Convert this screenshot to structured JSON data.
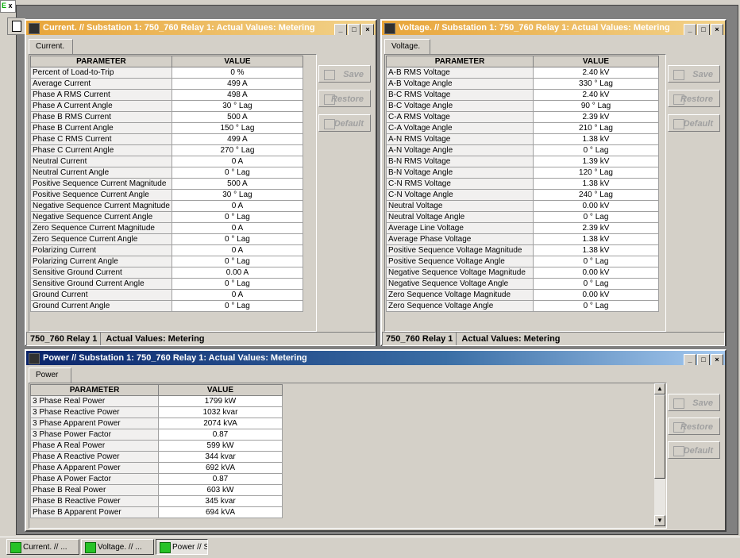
{
  "current_window": {
    "title": "Current. // Substation 1: 750_760 Relay 1: Actual Values: Metering",
    "tab": "Current.",
    "headers": [
      "PARAMETER",
      "VALUE"
    ],
    "rows": [
      [
        "Percent of Load-to-Trip",
        "0 %"
      ],
      [
        "Average Current",
        "499 A"
      ],
      [
        "Phase A RMS Current",
        "498 A"
      ],
      [
        "Phase A Current Angle",
        "30 ° Lag"
      ],
      [
        "Phase B RMS Current",
        "500 A"
      ],
      [
        "Phase B Current Angle",
        "150 ° Lag"
      ],
      [
        "Phase C RMS Current",
        "499 A"
      ],
      [
        "Phase C Current Angle",
        "270 ° Lag"
      ],
      [
        "Neutral Current",
        "0 A"
      ],
      [
        "Neutral Current Angle",
        "0 ° Lag"
      ],
      [
        "Positive Sequence Current Magnitude",
        "500 A"
      ],
      [
        "Positive Sequence Current Angle",
        "30 ° Lag"
      ],
      [
        "Negative Sequence Current Magnitude",
        "0 A"
      ],
      [
        "Negative Sequence Current Angle",
        "0 ° Lag"
      ],
      [
        "Zero Sequence Current Magnitude",
        "0 A"
      ],
      [
        "Zero Sequence Current Angle",
        "0 ° Lag"
      ],
      [
        "Polarizing Current",
        "0 A"
      ],
      [
        "Polarizing Current Angle",
        "0 ° Lag"
      ],
      [
        "Sensitive Ground Current",
        "0.00 A"
      ],
      [
        "Sensitive Ground Current Angle",
        "0 ° Lag"
      ],
      [
        "Ground Current",
        "0 A"
      ],
      [
        "Ground Current Angle",
        "0 ° Lag"
      ]
    ],
    "buttons": {
      "save": "Save",
      "restore": "Restore",
      "default": "Default"
    },
    "status_device": "750_760 Relay 1",
    "status_text": "Actual Values: Metering"
  },
  "voltage_window": {
    "title": "Voltage. // Substation 1: 750_760 Relay 1: Actual Values: Metering",
    "tab": "Voltage.",
    "headers": [
      "PARAMETER",
      "VALUE"
    ],
    "rows": [
      [
        "A-B RMS Voltage",
        "2.40 kV"
      ],
      [
        "A-B Voltage Angle",
        "330 ° Lag"
      ],
      [
        "B-C RMS Voltage",
        "2.40 kV"
      ],
      [
        "B-C Voltage Angle",
        "90 ° Lag"
      ],
      [
        "C-A RMS Voltage",
        "2.39 kV"
      ],
      [
        "C-A Voltage Angle",
        "210 ° Lag"
      ],
      [
        "A-N RMS Voltage",
        "1.38 kV"
      ],
      [
        "A-N Voltage Angle",
        "0 ° Lag"
      ],
      [
        "B-N RMS Voltage",
        "1.39 kV"
      ],
      [
        "B-N Voltage Angle",
        "120 ° Lag"
      ],
      [
        "C-N RMS Voltage",
        "1.38 kV"
      ],
      [
        "C-N Voltage Angle",
        "240 ° Lag"
      ],
      [
        "Neutral Voltage",
        "0.00 kV"
      ],
      [
        "Neutral Voltage Angle",
        "0 ° Lag"
      ],
      [
        "Average Line Voltage",
        "2.39 kV"
      ],
      [
        "Average Phase Voltage",
        "1.38 kV"
      ],
      [
        "Positive Sequence Voltage Magnitude",
        "1.38 kV"
      ],
      [
        "Positive Sequence Voltage Angle",
        "0 ° Lag"
      ],
      [
        "Negative Sequence Voltage Magnitude",
        "0.00 kV"
      ],
      [
        "Negative Sequence Voltage Angle",
        "0 ° Lag"
      ],
      [
        "Zero Sequence Voltage Magnitude",
        "0.00 kV"
      ],
      [
        "Zero Sequence Voltage Angle",
        "0 ° Lag"
      ]
    ],
    "buttons": {
      "save": "Save",
      "restore": "Restore",
      "default": "Default"
    },
    "status_device": "750_760 Relay 1",
    "status_text": "Actual Values: Metering"
  },
  "power_window": {
    "title": "Power // Substation 1: 750_760 Relay 1: Actual Values: Metering",
    "tab": "Power",
    "headers": [
      "PARAMETER",
      "VALUE"
    ],
    "rows": [
      [
        "3 Phase Real Power",
        "1799 kW"
      ],
      [
        "3 Phase Reactive Power",
        "1032 kvar"
      ],
      [
        "3 Phase Apparent Power",
        "2074 kVA"
      ],
      [
        "3 Phase Power Factor",
        "0.87"
      ],
      [
        "Phase A Real Power",
        "599 kW"
      ],
      [
        "Phase A Reactive Power",
        "344 kvar"
      ],
      [
        "Phase A Apparent Power",
        "692 kVA"
      ],
      [
        "Phase A Power Factor",
        "0.87"
      ],
      [
        "Phase B Real Power",
        "603 kW"
      ],
      [
        "Phase B Reactive Power",
        "345 kvar"
      ],
      [
        "Phase B Apparent Power",
        "694 kVA"
      ]
    ],
    "buttons": {
      "save": "Save",
      "restore": "Restore",
      "default": "Default"
    }
  },
  "taskbar": {
    "items": [
      "Current. // ...",
      "Voltage. // ...",
      "Power // Su..."
    ]
  },
  "colors": {
    "active_title": "#0a246a",
    "inactive_title_orange": "#e8a53a",
    "window_face": "#d4d0c8",
    "mdi_background": "#808080"
  }
}
